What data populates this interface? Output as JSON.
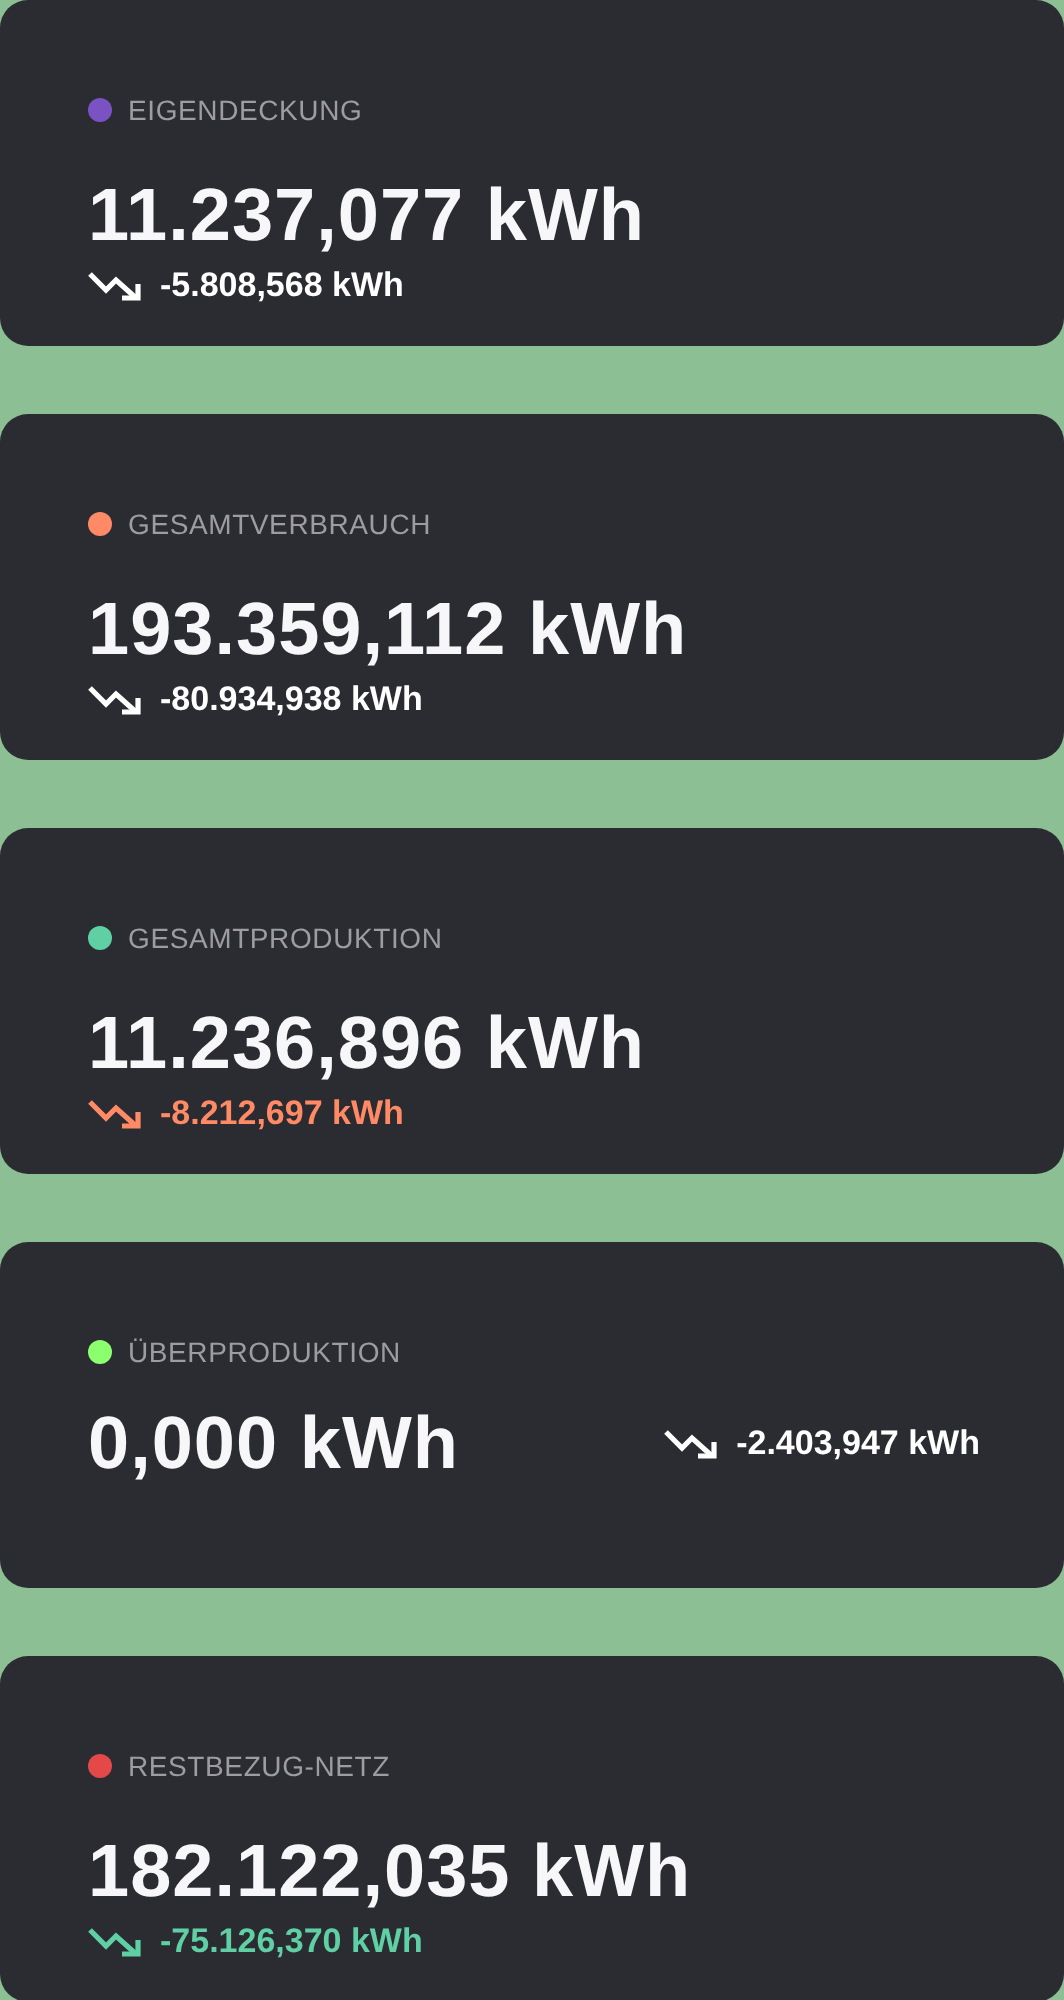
{
  "cards": [
    {
      "label": "EIGENDECKUNG",
      "color": "#7b52c4",
      "value": "11.237,077 kWh",
      "kind": "stacked",
      "change": {
        "text": "-5.808,568 kWh",
        "color": "#ffffff"
      }
    },
    {
      "label": "GESAMTVERBRAUCH",
      "color": "#ff8a65",
      "value": "193.359,112 kWh",
      "kind": "stacked",
      "change": {
        "text": "-80.934,938 kWh",
        "color": "#ffffff"
      }
    },
    {
      "label": "GESAMTPRODUKTION",
      "color": "#5fcfa4",
      "value": "11.236,896 kWh",
      "kind": "stacked",
      "change": {
        "text": "-8.212,697 kWh",
        "color": "#ff8a65"
      }
    },
    {
      "label": "ÜBERPRODUKTION",
      "color": "#8cff6e",
      "value": "0,000 kWh",
      "kind": "inline",
      "change": {
        "text": "-2.403,947 kWh",
        "color": "#ffffff"
      }
    },
    {
      "label": "RESTBEZUG-NETZ",
      "color": "#e54848",
      "value": "182.122,035 kWh",
      "kind": "stacked",
      "change": {
        "text": "-75.126,370 kWh",
        "color": "#5fcfa4"
      }
    }
  ]
}
